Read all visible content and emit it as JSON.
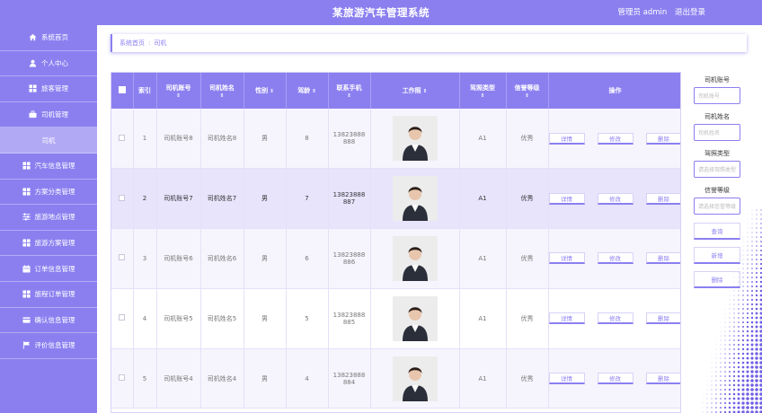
{
  "header": {
    "title": "某旅游汽车管理系统",
    "user": "管理员 admin",
    "logout": "退出登录"
  },
  "sidebar": {
    "items": [
      {
        "label": "系统首页",
        "icon": "home-icon"
      },
      {
        "label": "个人中心",
        "icon": "user-icon"
      },
      {
        "label": "旅客管理",
        "icon": "grid-icon"
      },
      {
        "label": "司机管理",
        "icon": "briefcase-icon"
      },
      {
        "label": "司机",
        "icon": ""
      },
      {
        "label": "汽车信息管理",
        "icon": "grid-icon"
      },
      {
        "label": "方案分类管理",
        "icon": "grid-icon"
      },
      {
        "label": "旅游地点管理",
        "icon": "sliders-icon"
      },
      {
        "label": "旅游方案管理",
        "icon": "grid-icon"
      },
      {
        "label": "订单信息管理",
        "icon": "calendar-icon"
      },
      {
        "label": "旅程订单管理",
        "icon": "grid-icon"
      },
      {
        "label": "确认信息管理",
        "icon": "card-icon"
      },
      {
        "label": "评价信息管理",
        "icon": "flag-icon"
      }
    ]
  },
  "breadcrumb": {
    "home": "系统首页",
    "sep": ":",
    "current": "司机"
  },
  "table": {
    "headers": {
      "index": "索引",
      "account": "司机账号",
      "name": "司机姓名",
      "gender": "性别",
      "age": "驾龄",
      "phone": "联系手机",
      "photo": "工作照",
      "license": "驾照类型",
      "credit": "信誉等级",
      "ops": "操作"
    },
    "sort_glyph": "⇕",
    "rows": [
      {
        "index": "1",
        "account": "司机账号8",
        "name": "司机姓名8",
        "gender": "男",
        "age": "8",
        "phone1": "13823888",
        "phone2": "888",
        "license": "A1",
        "credit": "优秀"
      },
      {
        "index": "2",
        "account": "司机账号7",
        "name": "司机姓名7",
        "gender": "男",
        "age": "7",
        "phone1": "13823888",
        "phone2": "887",
        "license": "A1",
        "credit": "优秀"
      },
      {
        "index": "3",
        "account": "司机账号6",
        "name": "司机姓名6",
        "gender": "男",
        "age": "6",
        "phone1": "13823888",
        "phone2": "886",
        "license": "A1",
        "credit": "优秀"
      },
      {
        "index": "4",
        "account": "司机账号5",
        "name": "司机姓名5",
        "gender": "男",
        "age": "5",
        "phone1": "13823888",
        "phone2": "885",
        "license": "A1",
        "credit": "优秀"
      },
      {
        "index": "5",
        "account": "司机账号4",
        "name": "司机姓名4",
        "gender": "男",
        "age": "4",
        "phone1": "13823888",
        "phone2": "884",
        "license": "A1",
        "credit": "优秀"
      }
    ],
    "actions": {
      "detail": "详情",
      "edit": "修改",
      "delete": "删除"
    }
  },
  "search": {
    "account_label": "司机账号",
    "account_placeholder": "司机账号",
    "name_label": "司机姓名",
    "name_placeholder": "司机姓名",
    "license_label": "驾照类型",
    "license_placeholder": "请选择驾照类型",
    "credit_label": "信誉等级",
    "credit_placeholder": "请选择信誉等级",
    "query": "查询",
    "add": "新增",
    "delete": "删除"
  },
  "colors": {
    "accent": "#8b7ff0",
    "row_alt": "#e7e4fc"
  }
}
